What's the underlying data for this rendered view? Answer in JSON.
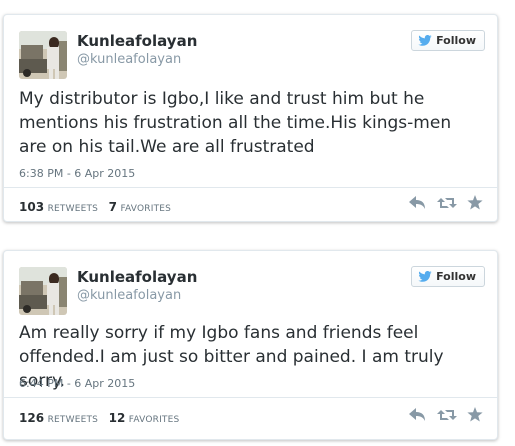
{
  "tweets": [
    {
      "name": "Kunleafolayan",
      "handle": "@kunleafolayan",
      "follow_label": "Follow",
      "text": "My distributor is Igbo,I like and trust him but he mentions his frustration all the time.His kings-men are on his tail.We are all frustrated",
      "timestamp": "6:38 PM - 6 Apr 2015",
      "retweets_count": "103",
      "retweets_label": "RETWEETS",
      "favorites_count": "7",
      "favorites_label": "FAVORITES"
    },
    {
      "name": "Kunleafolayan",
      "handle": "@kunleafolayan",
      "follow_label": "Follow",
      "text": "Am really sorry if my Igbo fans and friends feel offended.I am just so bitter and pained. I am truly sorry.",
      "timestamp": "6:44 PM - 6 Apr 2015",
      "retweets_count": "126",
      "retweets_label": "RETWEETS",
      "favorites_count": "12",
      "favorites_label": "FAVORITES"
    }
  ],
  "icons": {
    "follow": "twitter-bird-icon",
    "reply": "reply-icon",
    "retweet": "retweet-icon",
    "favorite": "star-icon"
  },
  "colors": {
    "bird": "#55acee",
    "text": "#292f33",
    "muted": "#66757f",
    "handle": "#8899a6",
    "action_icon": "#8899a6"
  }
}
